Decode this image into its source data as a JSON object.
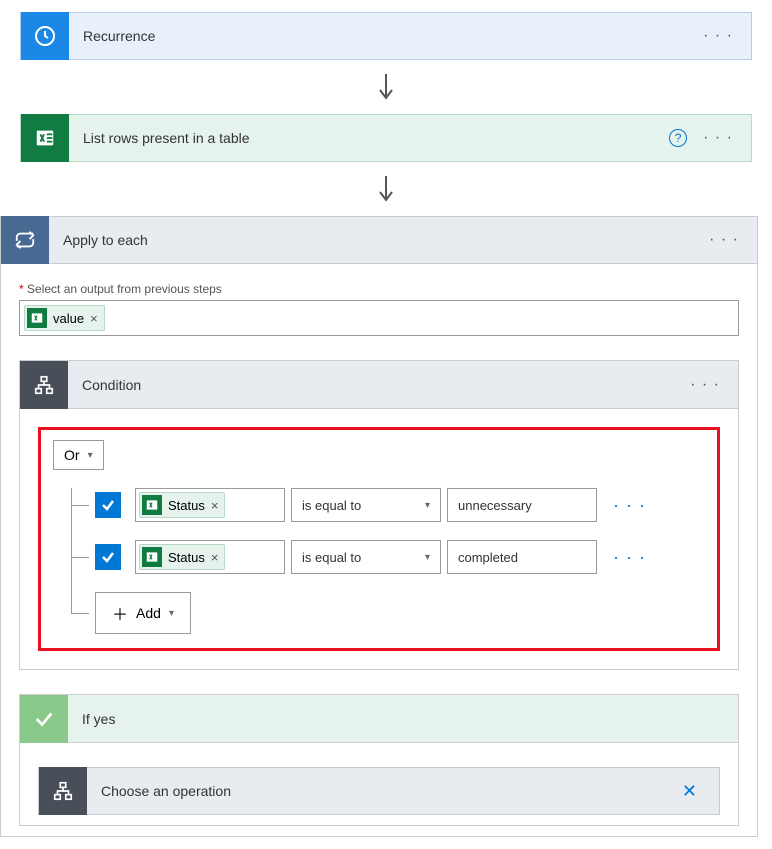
{
  "recurrence": {
    "title": "Recurrence"
  },
  "excel": {
    "title": "List rows present in a table"
  },
  "apply": {
    "title": "Apply to each",
    "select_label": "Select an output from previous steps",
    "token": "value"
  },
  "condition": {
    "title": "Condition",
    "logic": "Or",
    "rows": [
      {
        "field": "Status",
        "operator": "is equal to",
        "value": "unnecessary"
      },
      {
        "field": "Status",
        "operator": "is equal to",
        "value": "completed"
      }
    ],
    "add_label": "Add"
  },
  "ifyes": {
    "title": "If yes",
    "choose": "Choose an operation"
  }
}
